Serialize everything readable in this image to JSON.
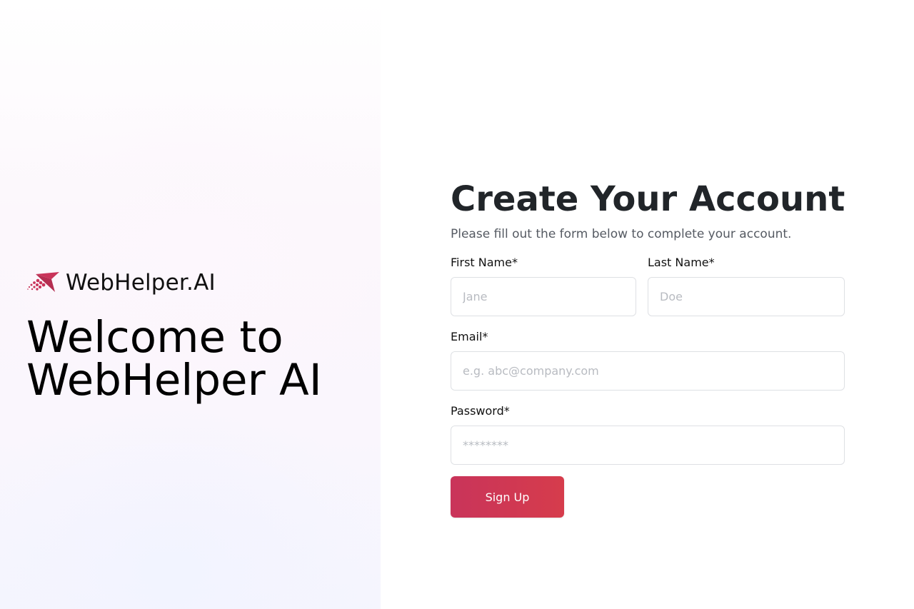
{
  "brand": {
    "logo_icon": "rocket-dots-icon",
    "name": "WebHelper.AI",
    "accent_color": "#c9345a"
  },
  "hero": {
    "heading": "Welcome to\nWebHelper AI"
  },
  "form": {
    "title": "Create Your Account",
    "subtitle": "Please fill out the form below to complete your account.",
    "first_name": {
      "label": "First Name*",
      "placeholder": "Jane",
      "value": ""
    },
    "last_name": {
      "label": "Last Name*",
      "placeholder": "Doe",
      "value": ""
    },
    "email": {
      "label": "Email*",
      "placeholder": "e.g. abc@company.com",
      "value": ""
    },
    "password": {
      "label": "Password*",
      "placeholder": "********",
      "value": ""
    },
    "submit_label": "Sign Up",
    "submit_color": "#c9345a"
  }
}
